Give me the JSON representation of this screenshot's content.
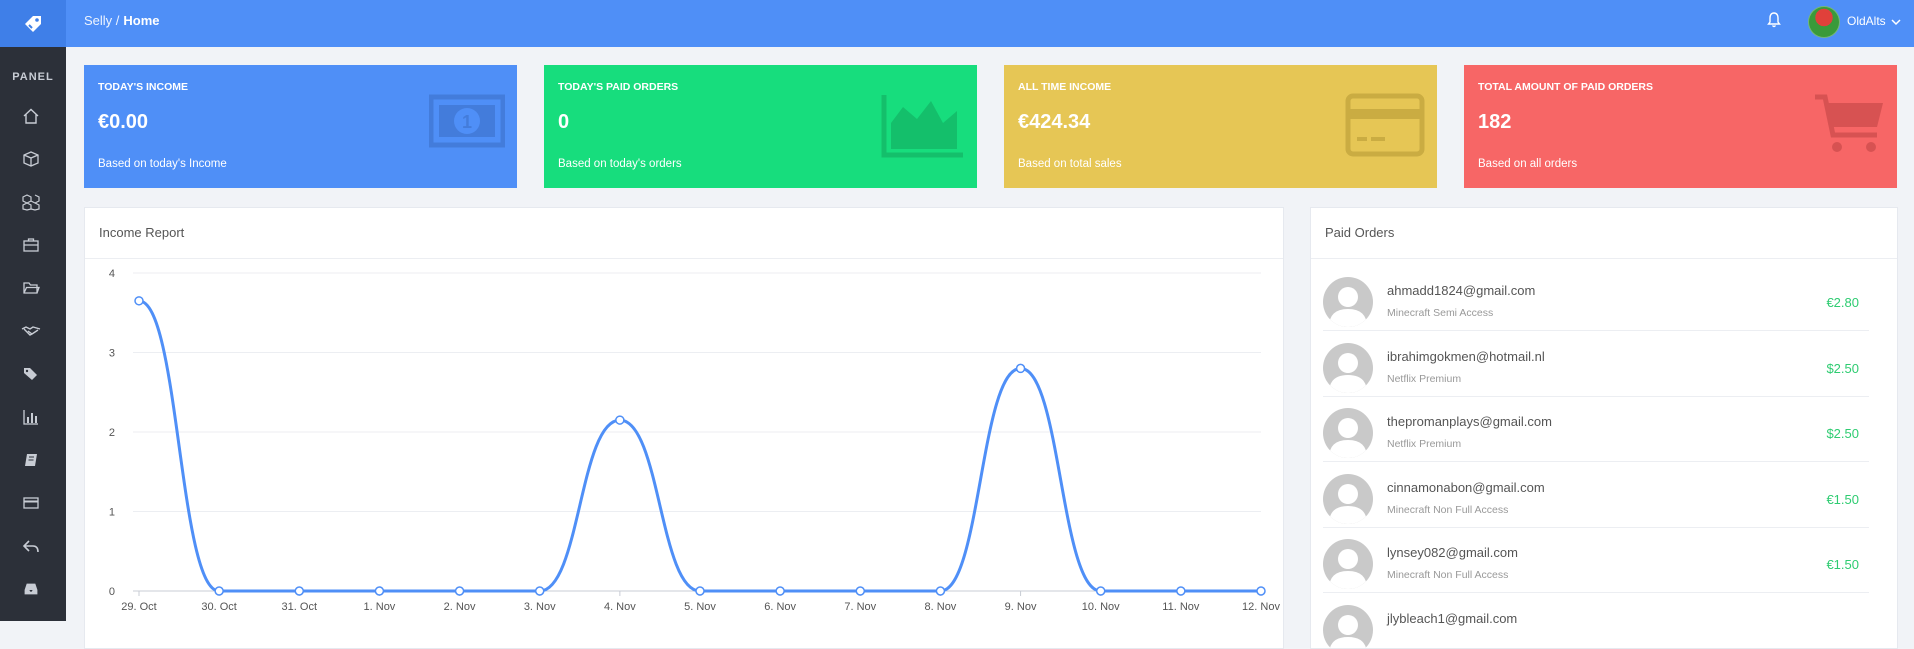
{
  "topbar": {
    "breadcrumb_root": "Selly /",
    "breadcrumb_current": "Home",
    "username": "OldAlts"
  },
  "sidebar": {
    "title": "PANEL",
    "icons": [
      "home-icon",
      "box-icon",
      "boxes-icon",
      "briefcase-icon",
      "folder-icon",
      "handshake-icon",
      "tags-icon",
      "bar-chart-icon",
      "book-icon",
      "credit-card-icon",
      "reply-icon",
      "inbox-icon"
    ]
  },
  "cards": [
    {
      "title": "TODAY'S INCOME",
      "value": "€0.00",
      "subtitle": "Based on today's Income",
      "color": "#4f8ff7",
      "icon": "money-icon"
    },
    {
      "title": "TODAY'S PAID ORDERS",
      "value": "0",
      "subtitle": "Based on today's orders",
      "color": "#17dd7d",
      "icon": "area-chart-icon"
    },
    {
      "title": "ALL TIME INCOME",
      "value": "€424.34",
      "subtitle": "Based on total sales",
      "color": "#e6c655",
      "icon": "credit-card-icon"
    },
    {
      "title": "TOTAL AMOUNT OF PAID ORDERS",
      "value": "182",
      "subtitle": "Based on all orders",
      "color": "#f76666",
      "icon": "cart-icon"
    }
  ],
  "income_panel": {
    "title": "Income Report"
  },
  "chart_data": {
    "type": "line",
    "categories": [
      "29. Oct",
      "30. Oct",
      "31. Oct",
      "1. Nov",
      "2. Nov",
      "3. Nov",
      "4. Nov",
      "5. Nov",
      "6. Nov",
      "7. Nov",
      "8. Nov",
      "9. Nov",
      "10. Nov",
      "11. Nov",
      "12. Nov"
    ],
    "values": [
      3.65,
      0,
      0,
      0,
      0,
      0,
      2.15,
      0,
      0,
      0,
      0,
      2.8,
      0,
      0,
      0
    ],
    "y_ticks": [
      0,
      1,
      2,
      3,
      4
    ],
    "ylim": [
      0,
      4
    ],
    "line_color": "#4f8ff7",
    "grid": true
  },
  "orders_panel": {
    "title": "Paid Orders",
    "orders": [
      {
        "email": "ahmadd1824@gmail.com",
        "product": "Minecraft Semi Access",
        "price": "€2.80"
      },
      {
        "email": "ibrahimgokmen@hotmail.nl",
        "product": "Netflix Premium",
        "price": "$2.50"
      },
      {
        "email": "thepromanplays@gmail.com",
        "product": "Netflix Premium",
        "price": "$2.50"
      },
      {
        "email": "cinnamonabon@gmail.com",
        "product": "Minecraft Non Full Access",
        "price": "€1.50"
      },
      {
        "email": "lynsey082@gmail.com",
        "product": "Minecraft Non Full Access",
        "price": "€1.50"
      },
      {
        "email": "jlybleach1@gmail.com",
        "product": "",
        "price": ""
      }
    ]
  }
}
